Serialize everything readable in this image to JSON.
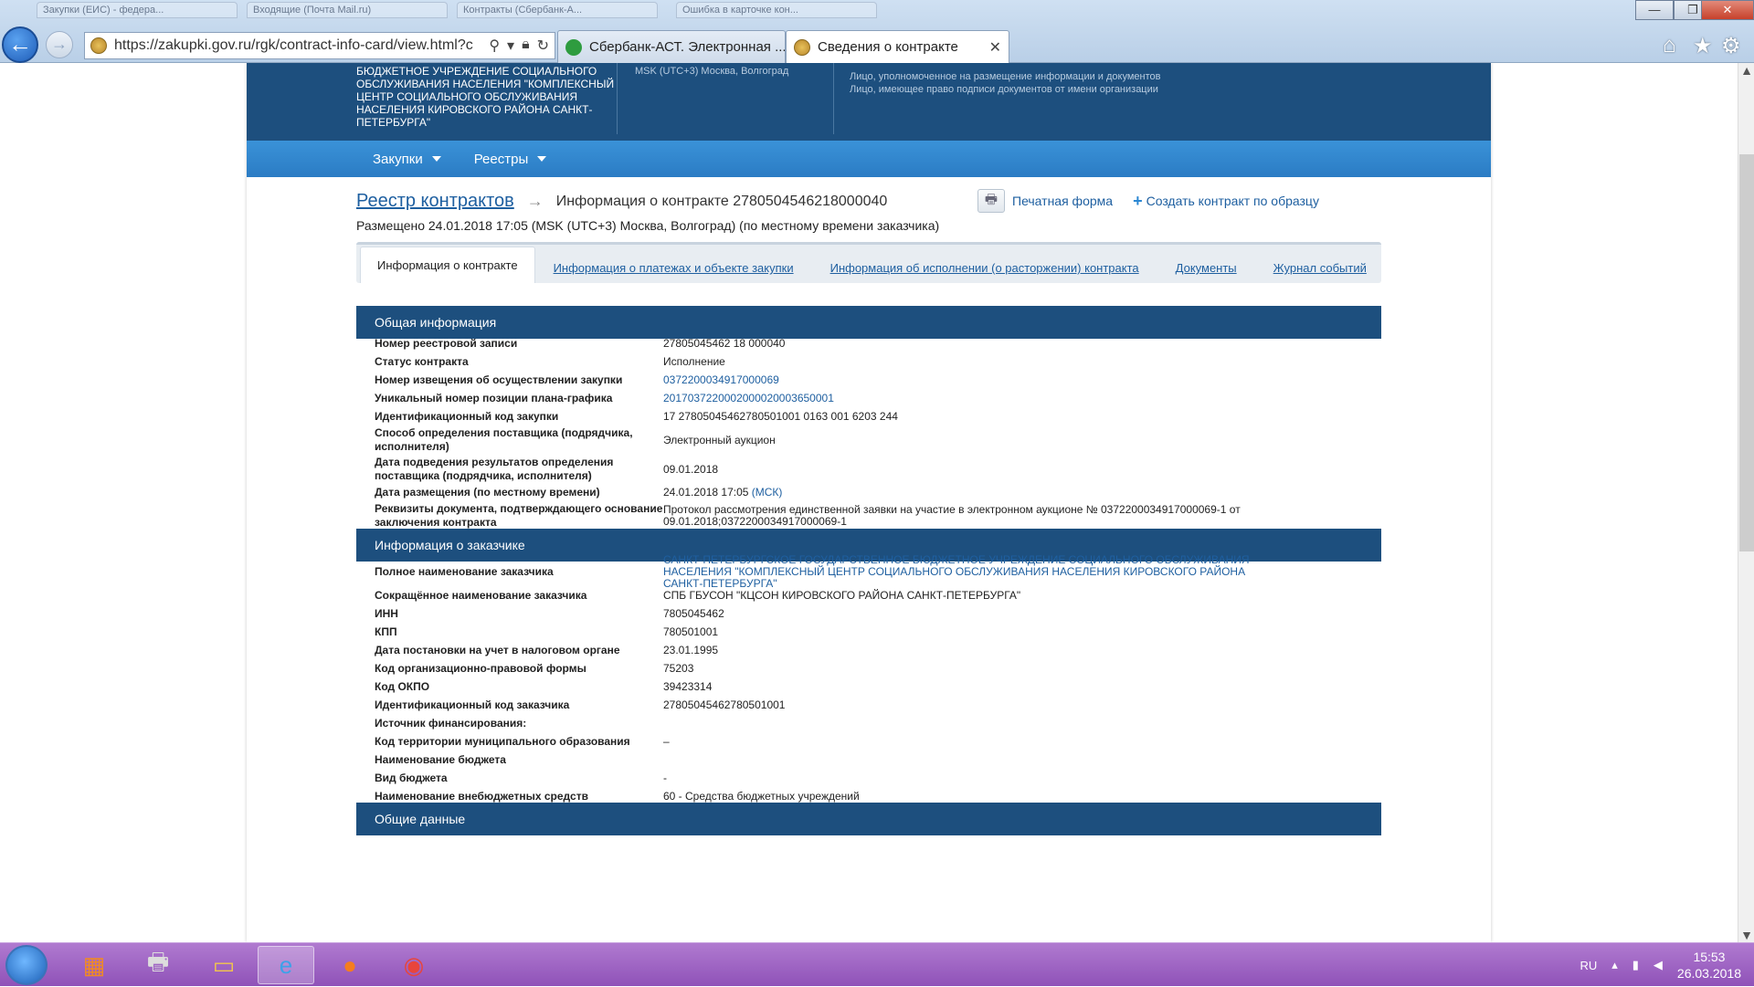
{
  "browser": {
    "ghost_tabs": [
      "Закупки (ЕИС) - федера...",
      "Входящие (Почта Mail.ru)",
      "Контракты (Сбербанк-А...",
      "Ошибка в карточке кон..."
    ],
    "window_buttons": {
      "minimize": "—",
      "maximize": "❐",
      "close": "✕"
    },
    "url": "https://zakupki.gov.ru/rgk/contract-info-card/view.html?c",
    "tabs": [
      {
        "label": "Сбербанк-АСТ. Электронная ..."
      },
      {
        "label": "Сведения о контракте"
      }
    ],
    "icons": {
      "back": "back-arrow-icon",
      "forward": "forward-arrow-icon",
      "home": "home-icon",
      "favorites": "star-icon",
      "settings": "gear-icon"
    }
  },
  "header": {
    "org_name": "БЮДЖЕТНОЕ УЧРЕЖДЕНИЕ СОЦИАЛЬНОГО ОБСЛУЖИВАНИЯ НАСЕЛЕНИЯ \"КОМПЛЕКСНЫЙ ЦЕНТР СОЦИАЛЬНОГО ОБСЛУЖИВАНИЯ НАСЕЛЕНИЯ КИРОВСКОГО РАЙОНА САНКТ-ПЕТЕРБУРГА\"",
    "timezone": "MSK (UTC+3) Москва, Волгоград",
    "sign_line1": "Лицо, уполномоченное на размещение информации и документов",
    "sign_line2": "Лицо, имеющее право подписи документов от имени организации"
  },
  "menu": [
    {
      "label": "Закупки"
    },
    {
      "label": "Реестры"
    }
  ],
  "breadcrumb": {
    "registry": "Реестр контрактов",
    "current": "Информация о контракте 2780504546218000040",
    "posted": "Размещено 24.01.2018 17:05 (MSK (UTC+3) Москва, Волгоград) (по местному времени заказчика)"
  },
  "actions": {
    "print": "Печатная форма",
    "create": "Создать контракт по образцу"
  },
  "content_tabs": [
    "Информация о контракте",
    "Информация о платежах и объекте закупки",
    "Информация об исполнении (о расторжении) контракта",
    "Документы",
    "Журнал событий"
  ],
  "sections": {
    "general": "Общая информация",
    "customer": "Информация о заказчике",
    "common": "Общие данные"
  },
  "general": [
    {
      "label": "Номер реестровой записи",
      "value": "27805045462 18 000040"
    },
    {
      "label": "Статус контракта",
      "value": "Исполнение"
    },
    {
      "label": "Номер извещения об осуществлении закупки",
      "value": "0372200034917000069"
    },
    {
      "label": "Уникальный номер позиции плана-графика",
      "value": "2017037220002000020003650001"
    },
    {
      "label": "Идентификационный код закупки",
      "value": "17 27805045462780501001 0163 001 6203 244"
    },
    {
      "label": "Способ определения поставщика (подрядчика, исполнителя)",
      "value": "Электронный аукцион"
    },
    {
      "label": "Дата подведения результатов определения поставщика (подрядчика, исполнителя)",
      "value": "09.01.2018"
    },
    {
      "label": "Дата размещения (по местному времени)",
      "value": "24.01.2018 17:05",
      "suffix": "(МСК)"
    },
    {
      "label": "Реквизиты документа, подтверждающего основание заключения контракта",
      "value": "Протокол рассмотрения единственной заявки на участие в электронном аукционе № 0372200034917000069-1 от 09.01.2018;0372200034917000069-1"
    }
  ],
  "customer": [
    {
      "label": "Полное наименование заказчика",
      "value": "САНКТ-ПЕТЕРБУРГСКОЕ ГОСУДАРСТВЕННОЕ БЮДЖЕТНОЕ УЧРЕЖДЕНИЕ СОЦИАЛЬНОГО ОБСЛУЖИВАНИЯ НАСЕЛЕНИЯ \"КОМПЛЕКСНЫЙ ЦЕНТР СОЦИАЛЬНОГО ОБСЛУЖИВАНИЯ НАСЕЛЕНИЯ КИРОВСКОГО РАЙОНА САНКТ-ПЕТЕРБУРГА\""
    },
    {
      "label": "Сокращённое наименование заказчика",
      "value": "СПБ ГБУСОН \"КЦСОН КИРОВСКОГО РАЙОНА САНКТ-ПЕТЕРБУРГА\""
    },
    {
      "label": "ИНН",
      "value": "7805045462"
    },
    {
      "label": "КПП",
      "value": "780501001"
    },
    {
      "label": "Дата постановки на учет в налоговом органе",
      "value": "23.01.1995"
    },
    {
      "label": "Код организационно-правовой формы",
      "value": "75203"
    },
    {
      "label": "Код ОКПО",
      "value": "39423314"
    },
    {
      "label": "Идентификационный код заказчика",
      "value": "27805045462780501001"
    },
    {
      "label": "Источник финансирования:",
      "value": ""
    },
    {
      "label": "Код территории муниципального образования",
      "value": "–"
    },
    {
      "label": "Наименование бюджета",
      "value": ""
    },
    {
      "label": "Вид бюджета",
      "value": "-"
    },
    {
      "label": "Наименование внебюджетных средств",
      "value": "60 - Средства бюджетных учреждений"
    }
  ],
  "taskbar": {
    "lang": "RU",
    "time": "15:53",
    "date": "26.03.2018"
  },
  "colors": {
    "header_blue": "#1d4f7e",
    "menu_blue": "#2b7cc4",
    "link": "#1e5fa0",
    "taskbar": "#9a62c2"
  }
}
